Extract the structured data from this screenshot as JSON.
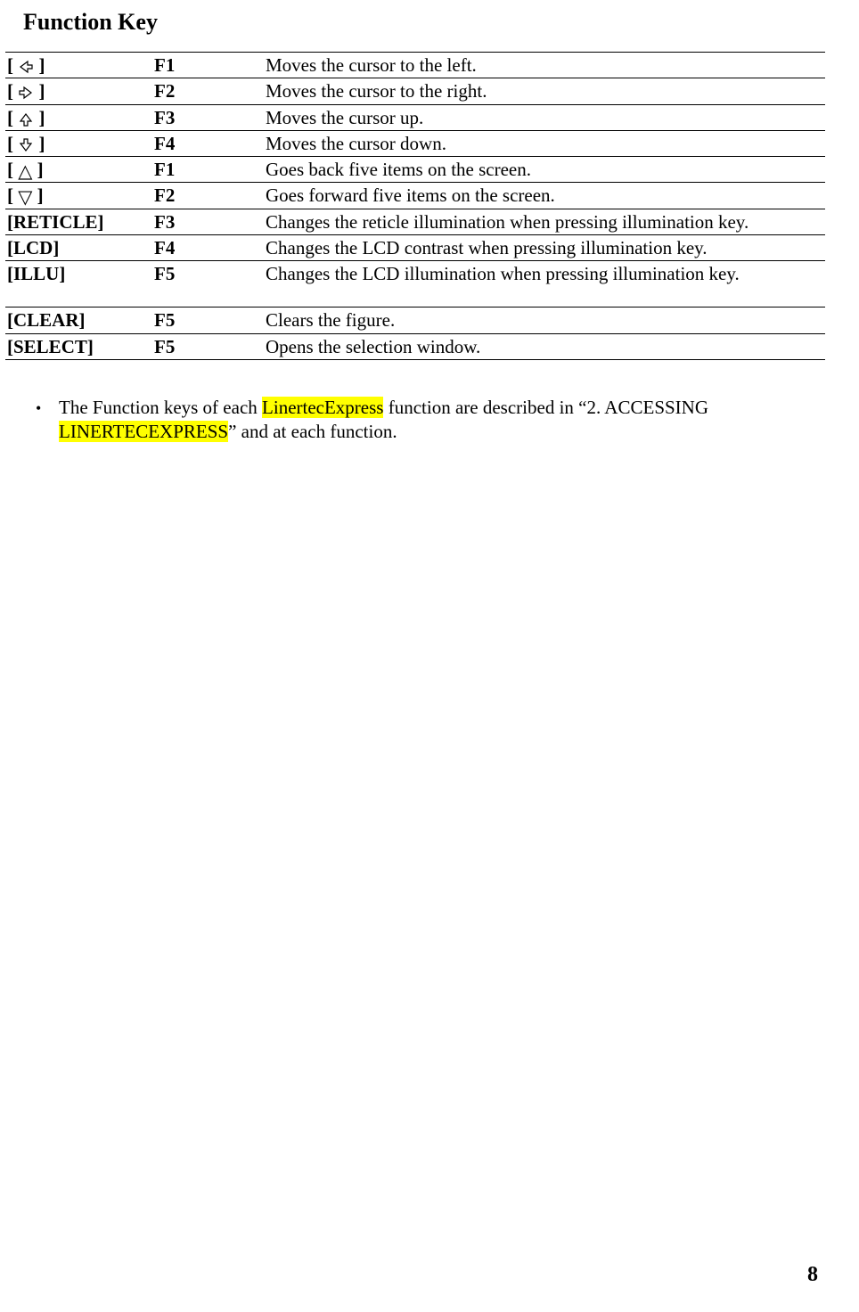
{
  "title": "Function Key",
  "rows": [
    {
      "icon_type": "svg-left",
      "icon_text_prefix": "[  ",
      "icon_text_suffix": " ]",
      "fkey": "F1",
      "desc": "Moves the cursor to the left."
    },
    {
      "icon_type": "svg-right",
      "icon_text_prefix": "[  ",
      "icon_text_suffix": "    ]",
      "fkey": "F2",
      "desc": "Moves the cursor to the right."
    },
    {
      "icon_type": "svg-up",
      "icon_text_prefix": "[  ",
      "icon_text_suffix": "    ]",
      "fkey": "F3",
      "desc": "Moves the cursor up."
    },
    {
      "icon_type": "svg-down",
      "icon_text_prefix": "[  ",
      "icon_text_suffix": "    ]",
      "fkey": "F4",
      "desc": "Moves the cursor down."
    },
    {
      "icon_type": "glyph-tri-up",
      "icon_text_prefix": "[  ",
      "icon_text_suffix": "  ]",
      "fkey": "F1",
      "desc": "Goes back five items on the screen."
    },
    {
      "icon_type": "glyph-tri-down",
      "icon_text_prefix": "[  ",
      "icon_text_suffix": "  ]",
      "fkey": "F2",
      "desc": "Goes forward five items on the screen."
    },
    {
      "icon_type": "text",
      "icon_label": "[RETICLE]",
      "fkey": "F3",
      "desc": "Changes the reticle illumination when pressing illumination key."
    },
    {
      "icon_type": "text",
      "icon_label": "[LCD]",
      "fkey": "F4",
      "desc": "Changes the LCD contrast when pressing illumination key."
    },
    {
      "icon_type": "text",
      "icon_label": "[ILLU]",
      "fkey": "F5",
      "desc": "Changes the LCD illumination when pressing illumination key.",
      "tall": true
    },
    {
      "icon_type": "text",
      "icon_label": "[CLEAR]",
      "fkey": "F5",
      "desc": "Clears the figure."
    },
    {
      "icon_type": "text",
      "icon_label": "[SELECT]",
      "fkey": "F5",
      "desc": "Opens the selection window."
    }
  ],
  "note": {
    "pre": "The Function keys of each ",
    "hl1": "LinertecExpress",
    "mid": " function are described in “2. ACCESSING ",
    "hl2": "LINERTECEXPRESS",
    "post": "” and at each function."
  },
  "page_number": "8"
}
